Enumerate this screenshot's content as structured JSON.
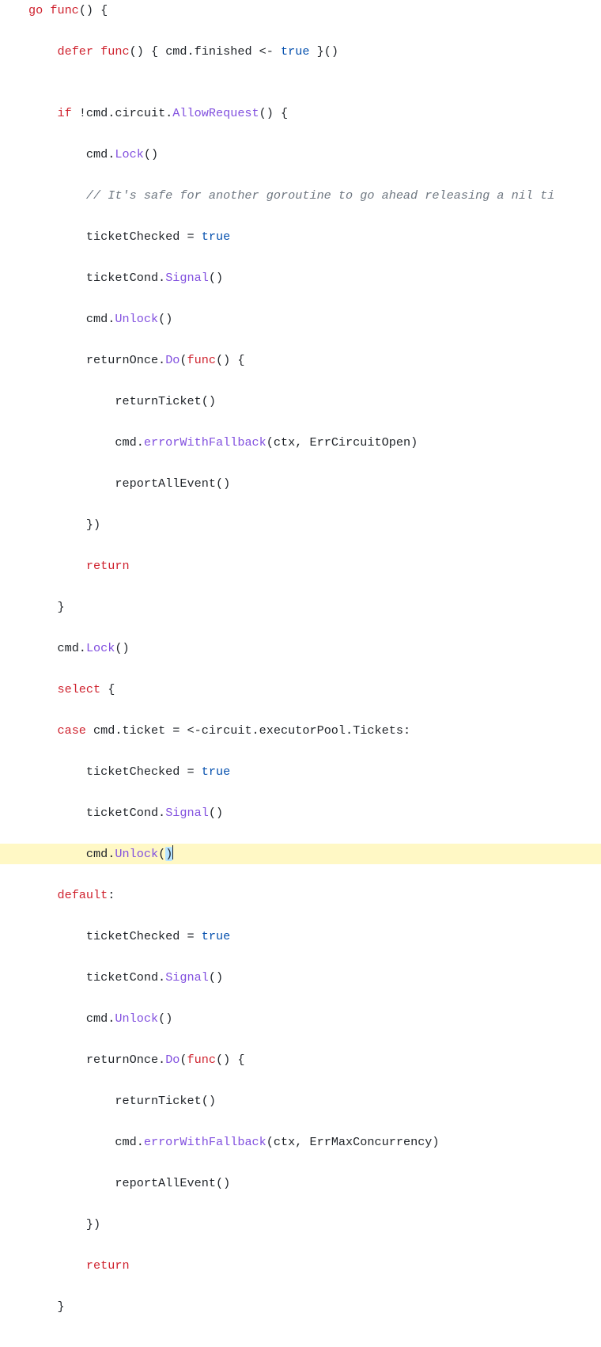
{
  "code": {
    "lines": [
      {
        "hl": false,
        "cursor": false,
        "indent": 0,
        "segments": [
          {
            "t": "go ",
            "c": "k"
          },
          {
            "t": "func",
            "c": "k"
          },
          {
            "t": "() {"
          }
        ]
      },
      {
        "hl": false,
        "cursor": false,
        "indent": 1,
        "segments": [
          {
            "t": "defer ",
            "c": "k"
          },
          {
            "t": "func",
            "c": "k"
          },
          {
            "t": "() { cmd.finished <- "
          },
          {
            "t": "true",
            "c": "b"
          },
          {
            "t": " }()"
          }
        ]
      },
      {
        "hl": false,
        "cursor": false,
        "indent": 0,
        "segments": []
      },
      {
        "hl": false,
        "cursor": false,
        "indent": 1,
        "segments": [
          {
            "t": "if ",
            "c": "k"
          },
          {
            "t": "!cmd.circuit."
          },
          {
            "t": "AllowRequest",
            "c": "fn"
          },
          {
            "t": "() {"
          }
        ]
      },
      {
        "hl": false,
        "cursor": false,
        "indent": 2,
        "segments": [
          {
            "t": "cmd."
          },
          {
            "t": "Lock",
            "c": "fn"
          },
          {
            "t": "()"
          }
        ]
      },
      {
        "hl": false,
        "cursor": false,
        "indent": 2,
        "segments": [
          {
            "t": "// It's safe for another goroutine to go ahead releasing a nil ti",
            "c": "c"
          }
        ]
      },
      {
        "hl": false,
        "cursor": false,
        "indent": 2,
        "segments": [
          {
            "t": "ticketChecked = "
          },
          {
            "t": "true",
            "c": "b"
          }
        ]
      },
      {
        "hl": false,
        "cursor": false,
        "indent": 2,
        "segments": [
          {
            "t": "ticketCond."
          },
          {
            "t": "Signal",
            "c": "fn"
          },
          {
            "t": "()"
          }
        ]
      },
      {
        "hl": false,
        "cursor": false,
        "indent": 2,
        "segments": [
          {
            "t": "cmd."
          },
          {
            "t": "Unlock",
            "c": "fn"
          },
          {
            "t": "()"
          }
        ]
      },
      {
        "hl": false,
        "cursor": false,
        "indent": 2,
        "segments": [
          {
            "t": "returnOnce."
          },
          {
            "t": "Do",
            "c": "fn"
          },
          {
            "t": "("
          },
          {
            "t": "func",
            "c": "k"
          },
          {
            "t": "() {"
          }
        ]
      },
      {
        "hl": false,
        "cursor": false,
        "indent": 3,
        "segments": [
          {
            "t": "returnTicket()"
          }
        ]
      },
      {
        "hl": false,
        "cursor": false,
        "indent": 3,
        "segments": [
          {
            "t": "cmd."
          },
          {
            "t": "errorWithFallback",
            "c": "fn"
          },
          {
            "t": "(ctx, ErrCircuitOpen)"
          }
        ]
      },
      {
        "hl": false,
        "cursor": false,
        "indent": 3,
        "segments": [
          {
            "t": "reportAllEvent()"
          }
        ]
      },
      {
        "hl": false,
        "cursor": false,
        "indent": 2,
        "segments": [
          {
            "t": "})"
          }
        ]
      },
      {
        "hl": false,
        "cursor": false,
        "indent": 2,
        "segments": [
          {
            "t": "return",
            "c": "k"
          }
        ]
      },
      {
        "hl": false,
        "cursor": false,
        "indent": 1,
        "segments": [
          {
            "t": "}"
          }
        ]
      },
      {
        "hl": false,
        "cursor": false,
        "indent": 1,
        "segments": [
          {
            "t": "cmd."
          },
          {
            "t": "Lock",
            "c": "fn"
          },
          {
            "t": "()"
          }
        ]
      },
      {
        "hl": false,
        "cursor": false,
        "indent": 1,
        "segments": [
          {
            "t": "select ",
            "c": "k"
          },
          {
            "t": "{"
          }
        ]
      },
      {
        "hl": false,
        "cursor": false,
        "indent": 1,
        "segments": [
          {
            "t": "case ",
            "c": "k"
          },
          {
            "t": "cmd.ticket = <-circuit.executorPool.Tickets:"
          }
        ]
      },
      {
        "hl": false,
        "cursor": false,
        "indent": 2,
        "segments": [
          {
            "t": "ticketChecked = "
          },
          {
            "t": "true",
            "c": "b"
          }
        ]
      },
      {
        "hl": false,
        "cursor": false,
        "indent": 2,
        "segments": [
          {
            "t": "ticketCond."
          },
          {
            "t": "Signal",
            "c": "fn"
          },
          {
            "t": "()"
          }
        ]
      },
      {
        "hl": true,
        "cursor": true,
        "indent": 2,
        "segments": [
          {
            "t": "cmd."
          },
          {
            "t": "Unlock",
            "c": "fn"
          },
          {
            "t": "("
          },
          {
            "t": ")",
            "c": "paren-hl"
          }
        ]
      },
      {
        "hl": false,
        "cursor": false,
        "indent": 1,
        "segments": [
          {
            "t": "default",
            "c": "k"
          },
          {
            "t": ":"
          }
        ]
      },
      {
        "hl": false,
        "cursor": false,
        "indent": 2,
        "segments": [
          {
            "t": "ticketChecked = "
          },
          {
            "t": "true",
            "c": "b"
          }
        ]
      },
      {
        "hl": false,
        "cursor": false,
        "indent": 2,
        "segments": [
          {
            "t": "ticketCond."
          },
          {
            "t": "Signal",
            "c": "fn"
          },
          {
            "t": "()"
          }
        ]
      },
      {
        "hl": false,
        "cursor": false,
        "indent": 2,
        "segments": [
          {
            "t": "cmd."
          },
          {
            "t": "Unlock",
            "c": "fn"
          },
          {
            "t": "()"
          }
        ]
      },
      {
        "hl": false,
        "cursor": false,
        "indent": 2,
        "segments": [
          {
            "t": "returnOnce."
          },
          {
            "t": "Do",
            "c": "fn"
          },
          {
            "t": "("
          },
          {
            "t": "func",
            "c": "k"
          },
          {
            "t": "() {"
          }
        ]
      },
      {
        "hl": false,
        "cursor": false,
        "indent": 3,
        "segments": [
          {
            "t": "returnTicket()"
          }
        ]
      },
      {
        "hl": false,
        "cursor": false,
        "indent": 3,
        "segments": [
          {
            "t": "cmd."
          },
          {
            "t": "errorWithFallback",
            "c": "fn"
          },
          {
            "t": "(ctx, ErrMaxConcurrency)"
          }
        ]
      },
      {
        "hl": false,
        "cursor": false,
        "indent": 3,
        "segments": [
          {
            "t": "reportAllEvent()"
          }
        ]
      },
      {
        "hl": false,
        "cursor": false,
        "indent": 2,
        "segments": [
          {
            "t": "})"
          }
        ]
      },
      {
        "hl": false,
        "cursor": false,
        "indent": 2,
        "segments": [
          {
            "t": "return",
            "c": "k"
          }
        ]
      },
      {
        "hl": false,
        "cursor": false,
        "indent": 1,
        "segments": [
          {
            "t": "}"
          }
        ]
      }
    ],
    "indent_unit": "    "
  }
}
